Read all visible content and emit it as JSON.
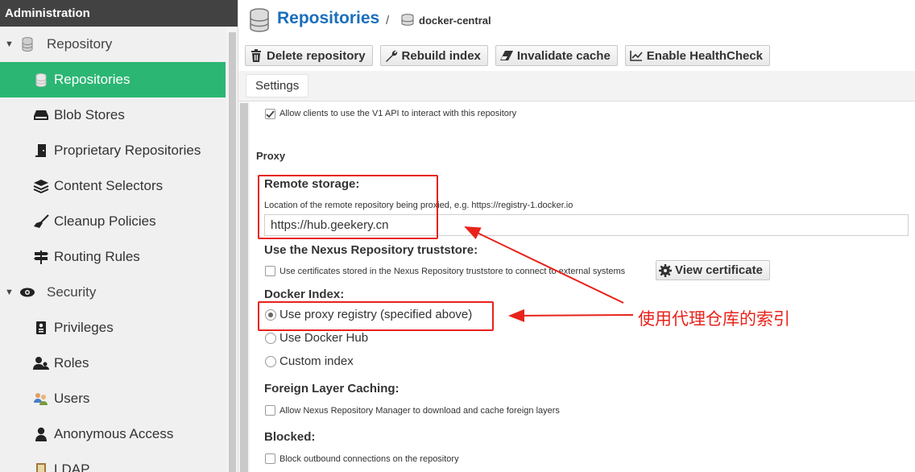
{
  "sidebar": {
    "header": "Administration",
    "sections": [
      {
        "label": "Repository",
        "icon": "database-icon"
      },
      {
        "label": "Security",
        "icon": "eye-icon"
      }
    ],
    "repository_items": [
      {
        "label": "Repositories",
        "icon": "database-icon",
        "active": true
      },
      {
        "label": "Blob Stores",
        "icon": "hard-drive-icon"
      },
      {
        "label": "Proprietary Repositories",
        "icon": "door-icon"
      },
      {
        "label": "Content Selectors",
        "icon": "layers-icon"
      },
      {
        "label": "Cleanup Policies",
        "icon": "broom-icon"
      },
      {
        "label": "Routing Rules",
        "icon": "signpost-icon"
      }
    ],
    "security_items": [
      {
        "label": "Privileges",
        "icon": "badge-icon"
      },
      {
        "label": "Roles",
        "icon": "users-icon"
      },
      {
        "label": "Users",
        "icon": "user-group-icon"
      },
      {
        "label": "Anonymous Access",
        "icon": "user-icon"
      },
      {
        "label": "LDAP",
        "icon": "book-icon"
      }
    ]
  },
  "header": {
    "title": "Repositories",
    "separator": "/",
    "repo_name": "docker-central"
  },
  "toolbar": {
    "delete": "Delete repository",
    "rebuild": "Rebuild index",
    "invalidate": "Invalidate cache",
    "healthcheck": "Enable HealthCheck"
  },
  "tabs": {
    "settings": "Settings"
  },
  "form": {
    "v1_api_label": "Allow clients to use the V1 API to interact with this repository",
    "v1_api_checked": true,
    "proxy_heading": "Proxy",
    "remote_storage_label": "Remote storage:",
    "remote_storage_help": "Location of the remote repository being proxied, e.g. https://registry-1.docker.io",
    "remote_storage_value": "https://hub.geekery.cn",
    "truststore_label": "Use the Nexus Repository truststore:",
    "truststore_help": "Use certificates stored in the Nexus Repository truststore to connect to external systems",
    "truststore_checked": false,
    "view_certificate": "View certificate",
    "docker_index_label": "Docker Index:",
    "docker_index_options": [
      "Use proxy registry (specified above)",
      "Use Docker Hub",
      "Custom index"
    ],
    "docker_index_selected": "Use proxy registry (specified above)",
    "foreign_layer_label": "Foreign Layer Caching:",
    "foreign_layer_help": "Allow Nexus Repository Manager to download and cache foreign layers",
    "foreign_layer_checked": false,
    "blocked_label": "Blocked:",
    "blocked_help": "Block outbound connections on the repository",
    "blocked_checked": false
  },
  "annotation": {
    "text": "使用代理仓库的索引",
    "color": "#e8231b"
  },
  "colors": {
    "active_nav": "#2cb673",
    "title_blue": "#1a6ebd",
    "header_dark": "#424242"
  }
}
